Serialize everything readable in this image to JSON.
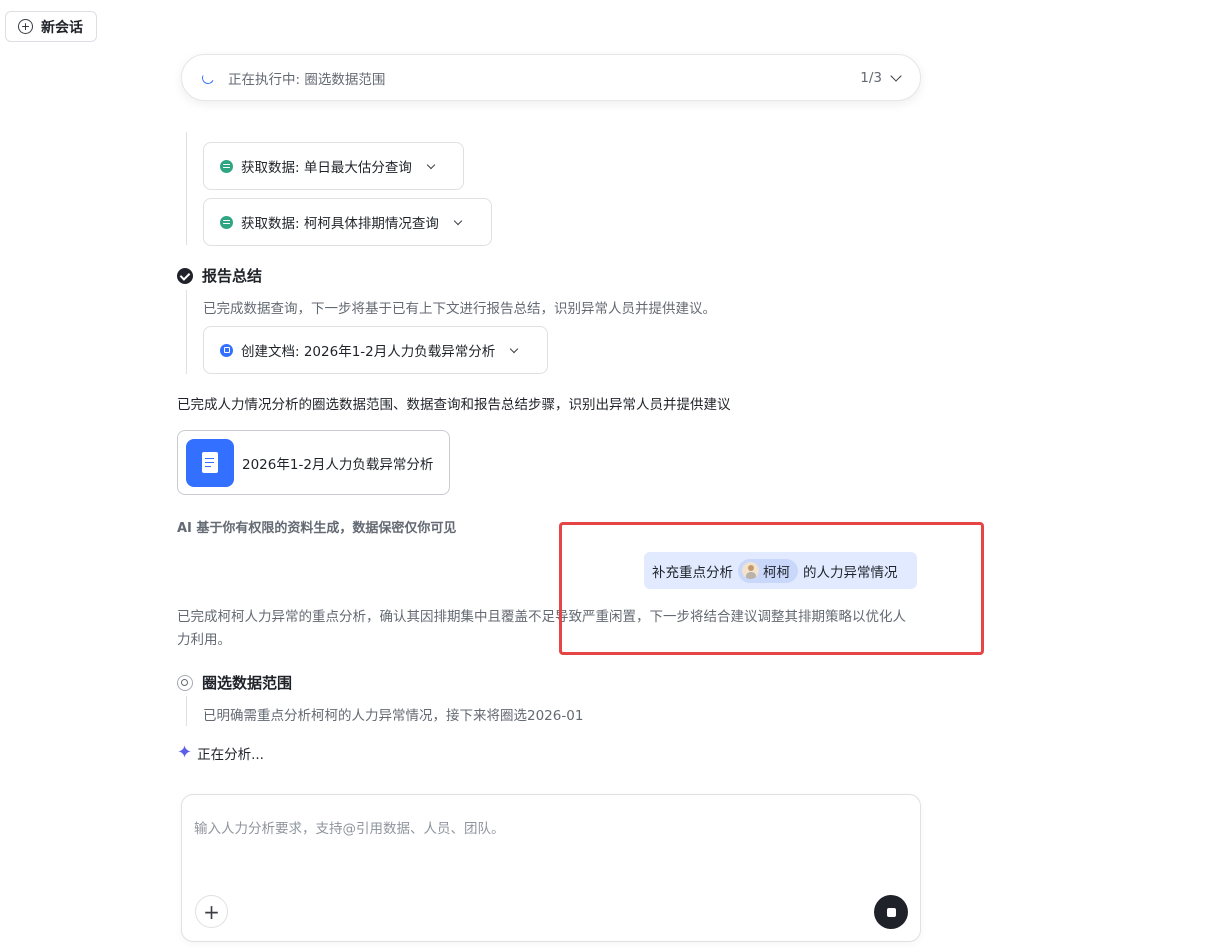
{
  "header": {
    "new_chat_label": "新会话"
  },
  "progress": {
    "status_text": "正在执行中: 圈选数据范围",
    "counter": "1/3"
  },
  "tool_calls": [
    {
      "label": "获取数据: 单日最大估分查询",
      "icon": "data-icon"
    },
    {
      "label": "获取数据: 柯柯具体排期情况查询",
      "icon": "data-icon"
    }
  ],
  "step_report": {
    "title": "报告总结",
    "description": "已完成数据查询，下一步将基于已有上下文进行报告总结，识别异常人员并提供建议。",
    "tool_label": "创建文档: 2026年1-2月人力负载异常分析"
  },
  "summary_text": "已完成人力情况分析的圈选数据范围、数据查询和报告总结步骤，识别出异常人员并提供建议",
  "doc_card": {
    "title": "2026年1-2月人力负载异常分析"
  },
  "disclaimer": "AI 基于你有权限的资料生成，数据保密仅你可见",
  "user_message": {
    "prefix": "补充重点分析",
    "mention": "柯柯",
    "suffix": "的人力异常情况"
  },
  "analysis_text": "已完成柯柯人力异常的重点分析，确认其因排期集中且覆盖不足导致严重闲置，下一步将结合建议调整其排期策略以优化人力利用。",
  "step_scope": {
    "title": "圈选数据范围",
    "description": "已明确需重点分析柯柯的人力异常情况，接下来将圈选2026-01"
  },
  "analyzing_text": "正在分析...",
  "input": {
    "placeholder": "输入人力分析要求，支持@引用数据、人员、团队。",
    "value": ""
  },
  "colors": {
    "accent": "#3370ff",
    "highlight_box": "#e54545",
    "bubble": "#e1eaff"
  }
}
